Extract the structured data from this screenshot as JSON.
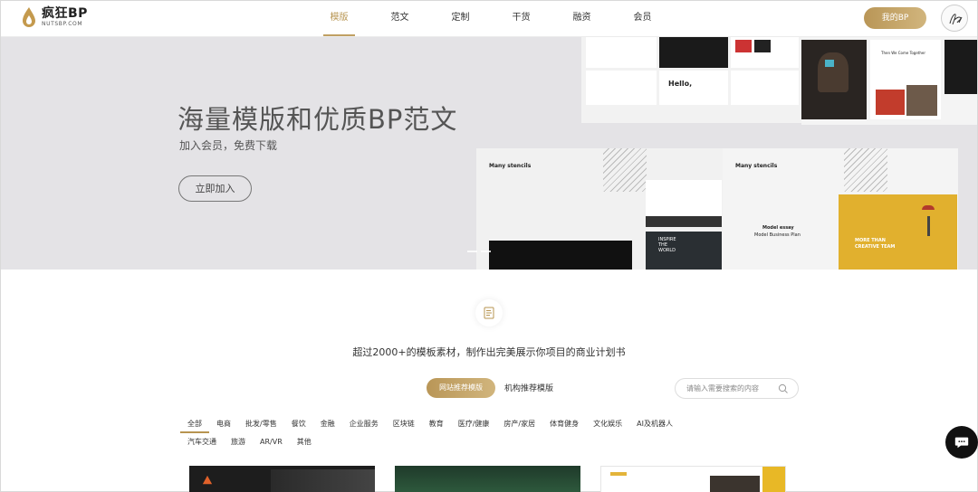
{
  "header": {
    "logo_name": "疯狂BP",
    "logo_sub": "NUTSBP.COM",
    "nav": [
      {
        "label": "模版",
        "active": true
      },
      {
        "label": "范文",
        "active": false
      },
      {
        "label": "定制",
        "active": false
      },
      {
        "label": "干货",
        "active": false
      },
      {
        "label": "融资",
        "active": false
      },
      {
        "label": "会员",
        "active": false
      }
    ],
    "my_bp_label": "我的BP"
  },
  "banner": {
    "title": "海量模版和优质BP范文",
    "subtitle": "加入会员，免费下载",
    "join_label": "立即加入",
    "mock_texts": {
      "hello": "Hello,",
      "many_stencils_1": "Many stencils",
      "many_stencils_2": "Many stencils",
      "model_essay": "Model essay",
      "model_plan": "Model Business Plan",
      "we_come": "Then We Come Together",
      "more_than": "MORE THAN",
      "creative_team": "CREATIVE TEAM",
      "inspire": "INSPIRE THE WORLD"
    }
  },
  "content": {
    "headline": "超过2000+的模板素材，制作出完美展示你项目的商业计划书",
    "tab_recommend": "网站推荐模版",
    "tab_org": "机构推荐模版",
    "search_placeholder": "请输入需要搜索的内容",
    "categories_row1": [
      {
        "label": "全部",
        "active": true
      },
      {
        "label": "电商"
      },
      {
        "label": "批发/零售"
      },
      {
        "label": "餐饮"
      },
      {
        "label": "金融"
      },
      {
        "label": "企业服务"
      },
      {
        "label": "区块链"
      },
      {
        "label": "教育"
      },
      {
        "label": "医疗/健康"
      },
      {
        "label": "房产/家居"
      },
      {
        "label": "体育健身"
      },
      {
        "label": "文化娱乐"
      },
      {
        "label": "AI及机器人"
      }
    ],
    "categories_row2": [
      {
        "label": "汽车交通"
      },
      {
        "label": "旅游"
      },
      {
        "label": "AR/VR"
      },
      {
        "label": "其他"
      }
    ]
  },
  "colors": {
    "accent": "#b79450",
    "banner_bg": "#e4e3e6",
    "chat_bg": "#111111"
  },
  "icons": [
    "logo-flame-icon",
    "document-icon",
    "search-icon",
    "chat-icon",
    "avatar-signature-icon"
  ]
}
